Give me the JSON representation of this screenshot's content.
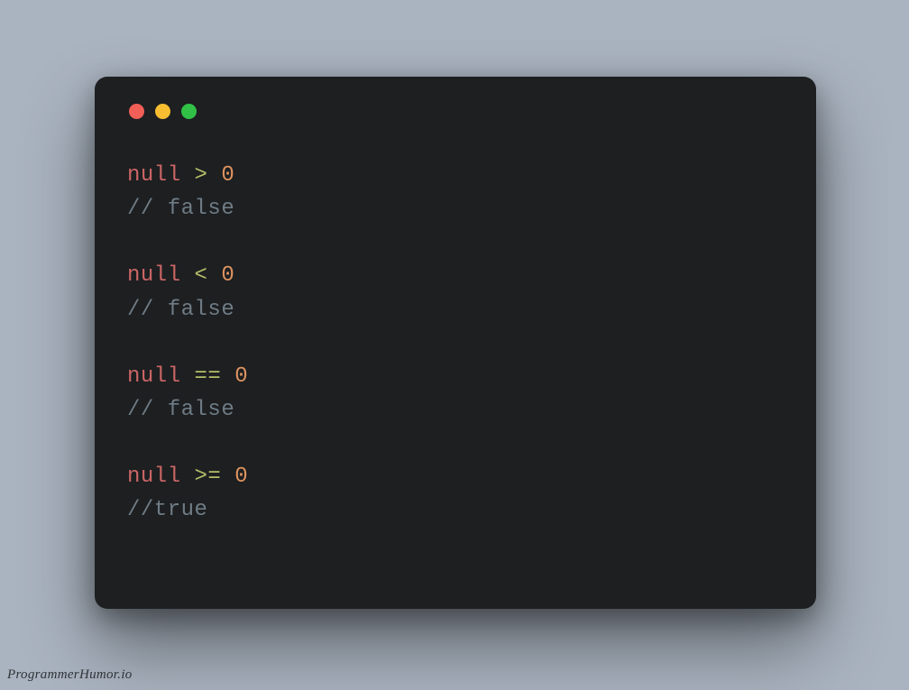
{
  "traffic_lights": [
    "red",
    "yellow",
    "green"
  ],
  "colors": {
    "background": "#aab4c0",
    "card": "#1d1f21",
    "null": "#cc6666",
    "operator": "#b5bd68",
    "number": "#de935f",
    "comment": "#6f7c85"
  },
  "code": {
    "blocks": [
      {
        "null": "null",
        "op": ">",
        "num": "0",
        "comment": "// false"
      },
      {
        "null": "null",
        "op": "<",
        "num": "0",
        "comment": "// false"
      },
      {
        "null": "null",
        "op": "==",
        "num": "0",
        "comment": "// false"
      },
      {
        "null": "null",
        "op": ">=",
        "num": "0",
        "comment": "//true"
      }
    ]
  },
  "watermark": "ProgrammerHumor.io"
}
